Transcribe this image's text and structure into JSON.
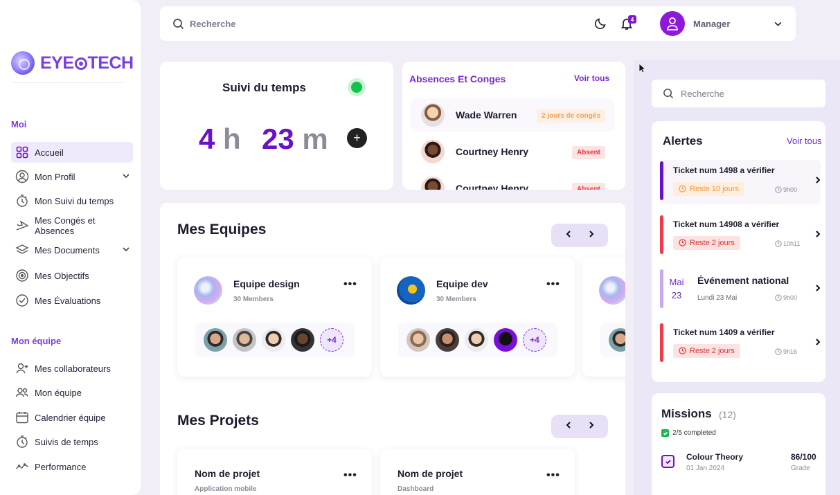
{
  "brand": {
    "name": "EYE",
    "name_suffix": "TECH"
  },
  "sidebar": {
    "section_me": "Moi",
    "section_team": "Mon équipe",
    "items": [
      {
        "label": "Accueil",
        "icon": "grid-icon",
        "active": true
      },
      {
        "label": "Mon Profil",
        "icon": "user-icon",
        "chevron": true
      },
      {
        "label": "Mon Suivi du temps",
        "icon": "stopwatch-icon"
      },
      {
        "label": "Mes Congés et Absences",
        "icon": "plane-icon"
      },
      {
        "label": "Mes Documents",
        "icon": "layers-icon",
        "chevron": true
      },
      {
        "label": "Mes Objectifs",
        "icon": "target-icon"
      },
      {
        "label": "Mes Évaluations",
        "icon": "check-circle-icon"
      }
    ],
    "team_items": [
      {
        "label": "Mes collaborateurs",
        "icon": "user-plus-icon"
      },
      {
        "label": "Mon équipe",
        "icon": "users-icon"
      },
      {
        "label": "Calendrier équipe",
        "icon": "calendar-icon"
      },
      {
        "label": "Suivis de temps",
        "icon": "stopwatch-icon"
      },
      {
        "label": "Performance",
        "icon": "chart-line-icon"
      }
    ]
  },
  "topbar": {
    "search_placeholder": "Recherche",
    "notifications_count": "4",
    "user_name": "Manager"
  },
  "time_tracking": {
    "title": "Suivi du temps",
    "hours": "4",
    "hours_unit": "h",
    "minutes": "23",
    "minutes_unit": "m",
    "status_color": "#14c14a"
  },
  "absences": {
    "title": "Absences Et Conges",
    "see_all": "Voir tous",
    "rows": [
      {
        "name": "Wade Warren",
        "status": "2 jours de congés",
        "type": "leave"
      },
      {
        "name": "Courtney Henry",
        "status": "Absent",
        "type": "absent"
      },
      {
        "name": "Courtney Henry",
        "status": "Absent",
        "type": "absent"
      }
    ]
  },
  "teams": {
    "title": "Mes Equipes",
    "cards": [
      {
        "name": "Equipe design",
        "members": "30 Members",
        "more": "+4"
      },
      {
        "name": "Equipe dev",
        "members": "30 Members",
        "more": "+4"
      }
    ]
  },
  "projects": {
    "title": "Mes Projets",
    "cards": [
      {
        "name": "Nom de projet",
        "sub": "Application mobile"
      },
      {
        "name": "Nom de projet",
        "sub": "Dashboard"
      }
    ]
  },
  "right_panel": {
    "search_placeholder": "Recherche",
    "alerts": {
      "title": "Alertes",
      "see_all": "Voir tous",
      "items": [
        {
          "title": "Ticket num 1498 a vérifier",
          "badge": "Reste 10 jours",
          "time": "9h00",
          "color": "#6a12c9",
          "kind": "orange"
        },
        {
          "title": "Ticket num 14908 a vérifier",
          "badge": "Reste 2 jours",
          "time": "10h11",
          "color": "#f03a47",
          "kind": "red"
        },
        {
          "title": "Événement national",
          "month": "Mai",
          "day": "23",
          "subtitle": "Lundi 23 Mai",
          "time": "9h00",
          "color": "#c9a8f0",
          "kind": "event"
        },
        {
          "title": "Ticket num 1409 a vérifier",
          "badge": "Reste 2 jours",
          "time": "9h16",
          "color": "#f03a47",
          "kind": "red"
        }
      ]
    },
    "missions": {
      "title": "Missions",
      "count": "(12)",
      "completed": "2/5 completed",
      "items": [
        {
          "name": "Colour Theory",
          "date": "01 Jan 2024",
          "score": "86/100",
          "score_label": "Grade"
        }
      ]
    }
  }
}
